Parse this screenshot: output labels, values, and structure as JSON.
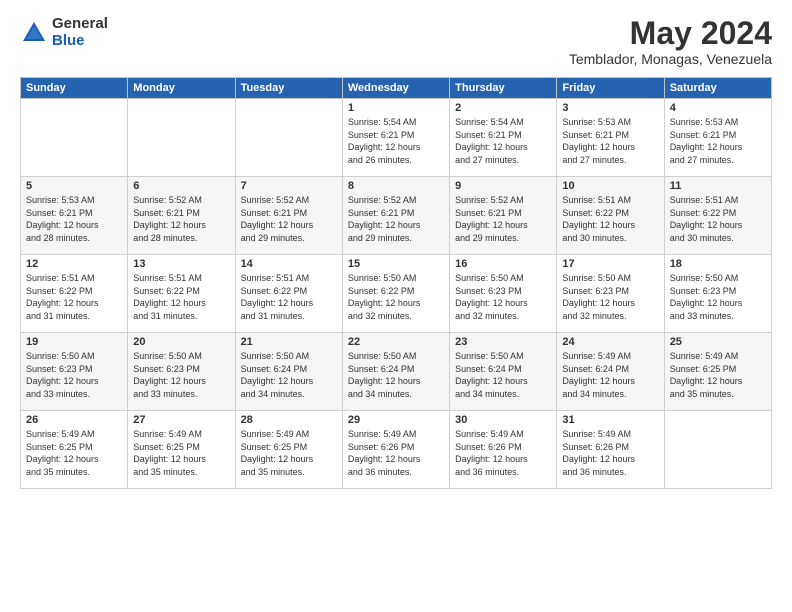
{
  "logo": {
    "general": "General",
    "blue": "Blue"
  },
  "header": {
    "month": "May 2024",
    "location": "Temblador, Monagas, Venezuela"
  },
  "days_of_week": [
    "Sunday",
    "Monday",
    "Tuesday",
    "Wednesday",
    "Thursday",
    "Friday",
    "Saturday"
  ],
  "weeks": [
    [
      {
        "day": "",
        "info": ""
      },
      {
        "day": "",
        "info": ""
      },
      {
        "day": "",
        "info": ""
      },
      {
        "day": "1",
        "info": "Sunrise: 5:54 AM\nSunset: 6:21 PM\nDaylight: 12 hours\nand 26 minutes."
      },
      {
        "day": "2",
        "info": "Sunrise: 5:54 AM\nSunset: 6:21 PM\nDaylight: 12 hours\nand 27 minutes."
      },
      {
        "day": "3",
        "info": "Sunrise: 5:53 AM\nSunset: 6:21 PM\nDaylight: 12 hours\nand 27 minutes."
      },
      {
        "day": "4",
        "info": "Sunrise: 5:53 AM\nSunset: 6:21 PM\nDaylight: 12 hours\nand 27 minutes."
      }
    ],
    [
      {
        "day": "5",
        "info": "Sunrise: 5:53 AM\nSunset: 6:21 PM\nDaylight: 12 hours\nand 28 minutes."
      },
      {
        "day": "6",
        "info": "Sunrise: 5:52 AM\nSunset: 6:21 PM\nDaylight: 12 hours\nand 28 minutes."
      },
      {
        "day": "7",
        "info": "Sunrise: 5:52 AM\nSunset: 6:21 PM\nDaylight: 12 hours\nand 29 minutes."
      },
      {
        "day": "8",
        "info": "Sunrise: 5:52 AM\nSunset: 6:21 PM\nDaylight: 12 hours\nand 29 minutes."
      },
      {
        "day": "9",
        "info": "Sunrise: 5:52 AM\nSunset: 6:21 PM\nDaylight: 12 hours\nand 29 minutes."
      },
      {
        "day": "10",
        "info": "Sunrise: 5:51 AM\nSunset: 6:22 PM\nDaylight: 12 hours\nand 30 minutes."
      },
      {
        "day": "11",
        "info": "Sunrise: 5:51 AM\nSunset: 6:22 PM\nDaylight: 12 hours\nand 30 minutes."
      }
    ],
    [
      {
        "day": "12",
        "info": "Sunrise: 5:51 AM\nSunset: 6:22 PM\nDaylight: 12 hours\nand 31 minutes."
      },
      {
        "day": "13",
        "info": "Sunrise: 5:51 AM\nSunset: 6:22 PM\nDaylight: 12 hours\nand 31 minutes."
      },
      {
        "day": "14",
        "info": "Sunrise: 5:51 AM\nSunset: 6:22 PM\nDaylight: 12 hours\nand 31 minutes."
      },
      {
        "day": "15",
        "info": "Sunrise: 5:50 AM\nSunset: 6:22 PM\nDaylight: 12 hours\nand 32 minutes."
      },
      {
        "day": "16",
        "info": "Sunrise: 5:50 AM\nSunset: 6:23 PM\nDaylight: 12 hours\nand 32 minutes."
      },
      {
        "day": "17",
        "info": "Sunrise: 5:50 AM\nSunset: 6:23 PM\nDaylight: 12 hours\nand 32 minutes."
      },
      {
        "day": "18",
        "info": "Sunrise: 5:50 AM\nSunset: 6:23 PM\nDaylight: 12 hours\nand 33 minutes."
      }
    ],
    [
      {
        "day": "19",
        "info": "Sunrise: 5:50 AM\nSunset: 6:23 PM\nDaylight: 12 hours\nand 33 minutes."
      },
      {
        "day": "20",
        "info": "Sunrise: 5:50 AM\nSunset: 6:23 PM\nDaylight: 12 hours\nand 33 minutes."
      },
      {
        "day": "21",
        "info": "Sunrise: 5:50 AM\nSunset: 6:24 PM\nDaylight: 12 hours\nand 34 minutes."
      },
      {
        "day": "22",
        "info": "Sunrise: 5:50 AM\nSunset: 6:24 PM\nDaylight: 12 hours\nand 34 minutes."
      },
      {
        "day": "23",
        "info": "Sunrise: 5:50 AM\nSunset: 6:24 PM\nDaylight: 12 hours\nand 34 minutes."
      },
      {
        "day": "24",
        "info": "Sunrise: 5:49 AM\nSunset: 6:24 PM\nDaylight: 12 hours\nand 34 minutes."
      },
      {
        "day": "25",
        "info": "Sunrise: 5:49 AM\nSunset: 6:25 PM\nDaylight: 12 hours\nand 35 minutes."
      }
    ],
    [
      {
        "day": "26",
        "info": "Sunrise: 5:49 AM\nSunset: 6:25 PM\nDaylight: 12 hours\nand 35 minutes."
      },
      {
        "day": "27",
        "info": "Sunrise: 5:49 AM\nSunset: 6:25 PM\nDaylight: 12 hours\nand 35 minutes."
      },
      {
        "day": "28",
        "info": "Sunrise: 5:49 AM\nSunset: 6:25 PM\nDaylight: 12 hours\nand 35 minutes."
      },
      {
        "day": "29",
        "info": "Sunrise: 5:49 AM\nSunset: 6:26 PM\nDaylight: 12 hours\nand 36 minutes."
      },
      {
        "day": "30",
        "info": "Sunrise: 5:49 AM\nSunset: 6:26 PM\nDaylight: 12 hours\nand 36 minutes."
      },
      {
        "day": "31",
        "info": "Sunrise: 5:49 AM\nSunset: 6:26 PM\nDaylight: 12 hours\nand 36 minutes."
      },
      {
        "day": "",
        "info": ""
      }
    ]
  ]
}
